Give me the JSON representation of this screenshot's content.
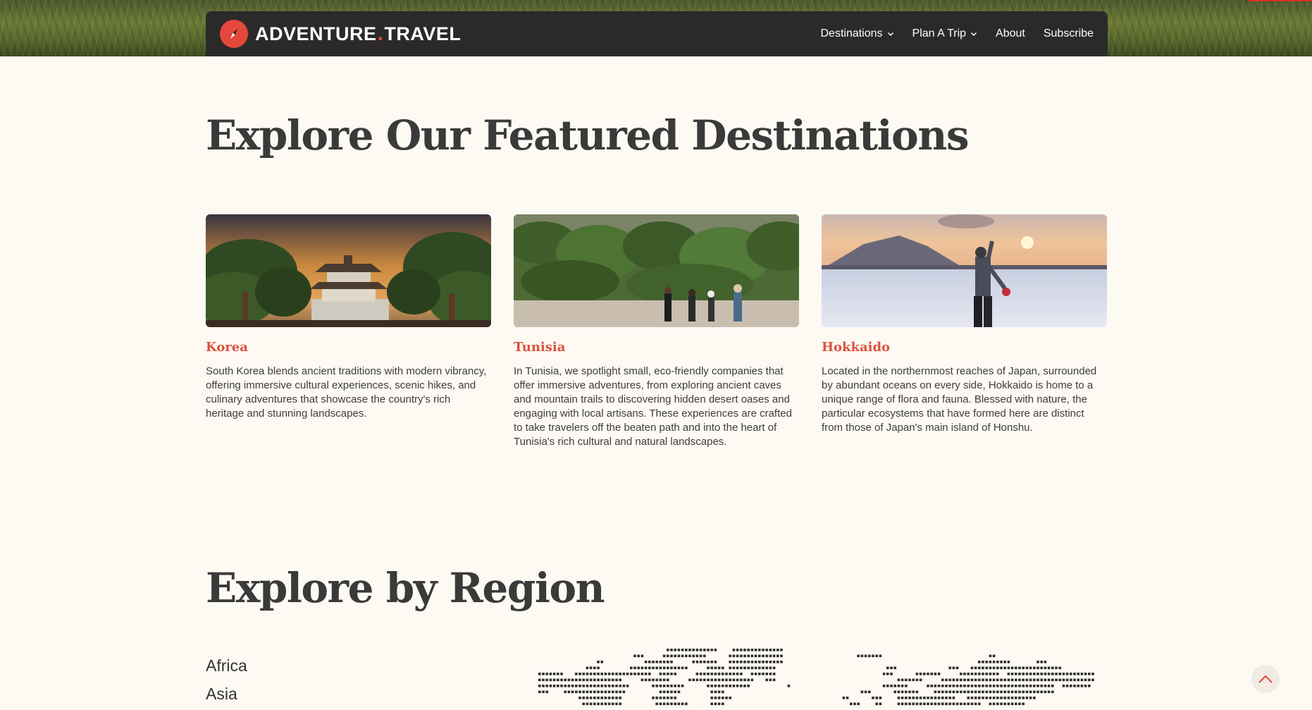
{
  "header": {
    "brand_left": "ADVENTURE",
    "brand_dot": ".",
    "brand_right": "TRAVEL",
    "logo_icon": "compass-icon",
    "nav": [
      {
        "label": "Destinations",
        "has_dropdown": true
      },
      {
        "label": "Plan A Trip",
        "has_dropdown": true
      },
      {
        "label": "About",
        "has_dropdown": false
      },
      {
        "label": "Subscribe",
        "has_dropdown": false
      }
    ]
  },
  "featured": {
    "title": "Explore Our Featured Destinations",
    "cards": [
      {
        "title": "Korea",
        "description": "South Korea blends ancient traditions with modern vibrancy, offering immersive cultural experiences, scenic hikes, and culinary adventures that showcase the country's rich heritage and stunning landscapes."
      },
      {
        "title": "Tunisia",
        "description": "In Tunisia, we spotlight small, eco-friendly companies that offer immersive adventures, from exploring ancient caves and mountain trails to discovering hidden desert oases and engaging with local artisans. These experiences are crafted to take travelers off the beaten path and into the heart of Tunisia's rich cultural and natural landscapes."
      },
      {
        "title": "Hokkaido",
        "description": "Located in the northernmost reaches of Japan, surrounded by abundant oceans on every side, Hokkaido is home to a unique range of flora and fauna. Blessed with nature, the particular ecosystems that have formed here are distinct from those of Japan's main island of Honshu."
      }
    ]
  },
  "regions": {
    "title": "Explore by Region",
    "items": [
      "Africa",
      "Asia"
    ]
  },
  "colors": {
    "accent": "#e5483b",
    "nav_bg": "#2c2a29",
    "page_bg": "#fdf9f3",
    "card_title": "#d9533f"
  },
  "icons": {
    "scroll_top": "chevron-up-icon",
    "dropdown": "chevron-down-icon"
  }
}
